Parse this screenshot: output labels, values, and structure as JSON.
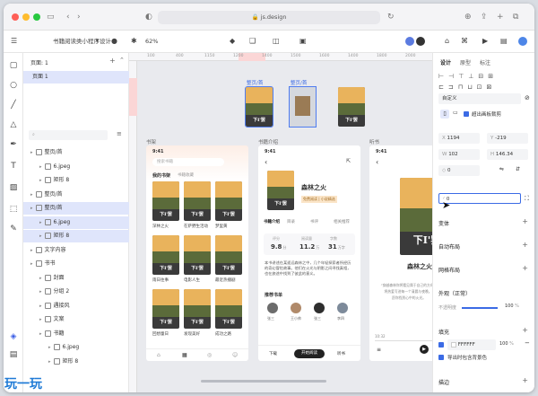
{
  "browser": {
    "url": "js.design",
    "colors": {
      "close": "#fe5f57",
      "min": "#febc2e",
      "max": "#28c840"
    }
  },
  "toolbar": {
    "file_title": "书籍阅读类小程序设计",
    "zoom": "62%"
  },
  "layers": {
    "page_label": "页面",
    "page_count": "1",
    "page_item": "页面 1",
    "search_placeholder": "",
    "items": [
      {
        "label": "整页/首",
        "depth": 0,
        "selected": false
      },
      {
        "label": "6.jpeg",
        "depth": 1,
        "selected": false
      },
      {
        "label": "矩形 8",
        "depth": 1,
        "selected": false
      },
      {
        "label": "整页/首",
        "depth": 0,
        "selected": false
      },
      {
        "label": "整页/首",
        "depth": 0,
        "selected": true
      },
      {
        "label": "6.jpeg",
        "depth": 1,
        "selected": true
      },
      {
        "label": "矩形 8",
        "depth": 1,
        "selected": true
      },
      {
        "label": "文字内容",
        "depth": 0,
        "selected": false
      },
      {
        "label": "书书",
        "depth": 0,
        "selected": false
      },
      {
        "label": "封面",
        "depth": 1,
        "selected": false
      },
      {
        "label": "分组 2",
        "depth": 1,
        "selected": false
      },
      {
        "label": "遇接风",
        "depth": 1,
        "selected": false
      },
      {
        "label": "文案",
        "depth": 1,
        "selected": false
      },
      {
        "label": "书籍",
        "depth": 1,
        "selected": false
      },
      {
        "label": "6.jpeg",
        "depth": 2,
        "selected": false
      },
      {
        "label": "矩形 8",
        "depth": 2,
        "selected": false
      }
    ]
  },
  "canvas": {
    "ruler_ticks": [
      "100",
      "400",
      "1150",
      "1200",
      "1400",
      "1500",
      "1600",
      "1400",
      "1800",
      "2000"
    ],
    "top_labels": [
      "整页/首",
      "整页/首"
    ],
    "frame_labels": [
      "书架",
      "书籍介绍",
      "听书"
    ],
    "frame1": {
      "time": "9:41",
      "search_placeholder": "搜索书籍",
      "tabs": [
        "我的书架",
        "书籍收藏"
      ],
      "books": [
        {
          "title": "深林之火"
        },
        {
          "title": "在萨野生活动"
        },
        {
          "title": "梦里黄"
        },
        {
          "title": "雨日往事"
        },
        {
          "title": "电影人生"
        },
        {
          "title": "最近热播剧"
        },
        {
          "title": "回想童日"
        },
        {
          "title": "发现美好"
        },
        {
          "title": "成功之路"
        }
      ],
      "cover_text": "下I'罢"
    },
    "frame2": {
      "time": "9:41",
      "book_title": "森林之火",
      "badge": "免费阅读 | 小说精选",
      "tabs": [
        "书籍介绍",
        "目录",
        "书评",
        "相关推荐"
      ],
      "stats": [
        {
          "label": "评分",
          "value": "9.8",
          "unit": "分"
        },
        {
          "label": "阅读量",
          "value": "11.2",
          "unit": "万"
        },
        {
          "label": "字数",
          "value": "31",
          "unit": "万字"
        }
      ],
      "intro": "本书讲述在某遥远森林之中，几个年轻探索者所经历的奇幻冒险故事。他们在火光与阴影之间寻找真相，也在旅途中找到了彼此的意义。",
      "section": "推荐书单",
      "people": [
        "张三",
        "王小帅",
        "张三",
        "李四"
      ],
      "actions": [
        "下载",
        "开始阅读",
        "听书"
      ]
    },
    "frame3": {
      "time": "9:41",
      "book_title": "森林之火",
      "quote_lines": [
        "“穿越森林你将看见属于自己的方向，",
        "将热爱写进每一个清晨与夜晚。”",
        "愿你找到心中的火光。"
      ],
      "time_start": "10:32",
      "time_end": "—"
    }
  },
  "props": {
    "tabs": [
      "设计",
      "原型",
      "标注"
    ],
    "style_name": "自定义",
    "clip_label": "超出画板裁剪",
    "fields": {
      "x": "1194",
      "y": "-219",
      "w": "102",
      "h": "146.34",
      "rotation": "0",
      "radius": "0"
    },
    "sections": [
      "变体",
      "自动布局",
      "网格布局",
      "外观（正常）",
      "填充",
      "描边"
    ],
    "opacity_label": "不透明度",
    "opacity_value": "100",
    "opacity_unit": "%",
    "fill_hex": "FFFFFF",
    "fill_opacity": "100",
    "fill_unit": "%",
    "export_label": "导出时包含背景色"
  },
  "watermark": "玩一玩"
}
